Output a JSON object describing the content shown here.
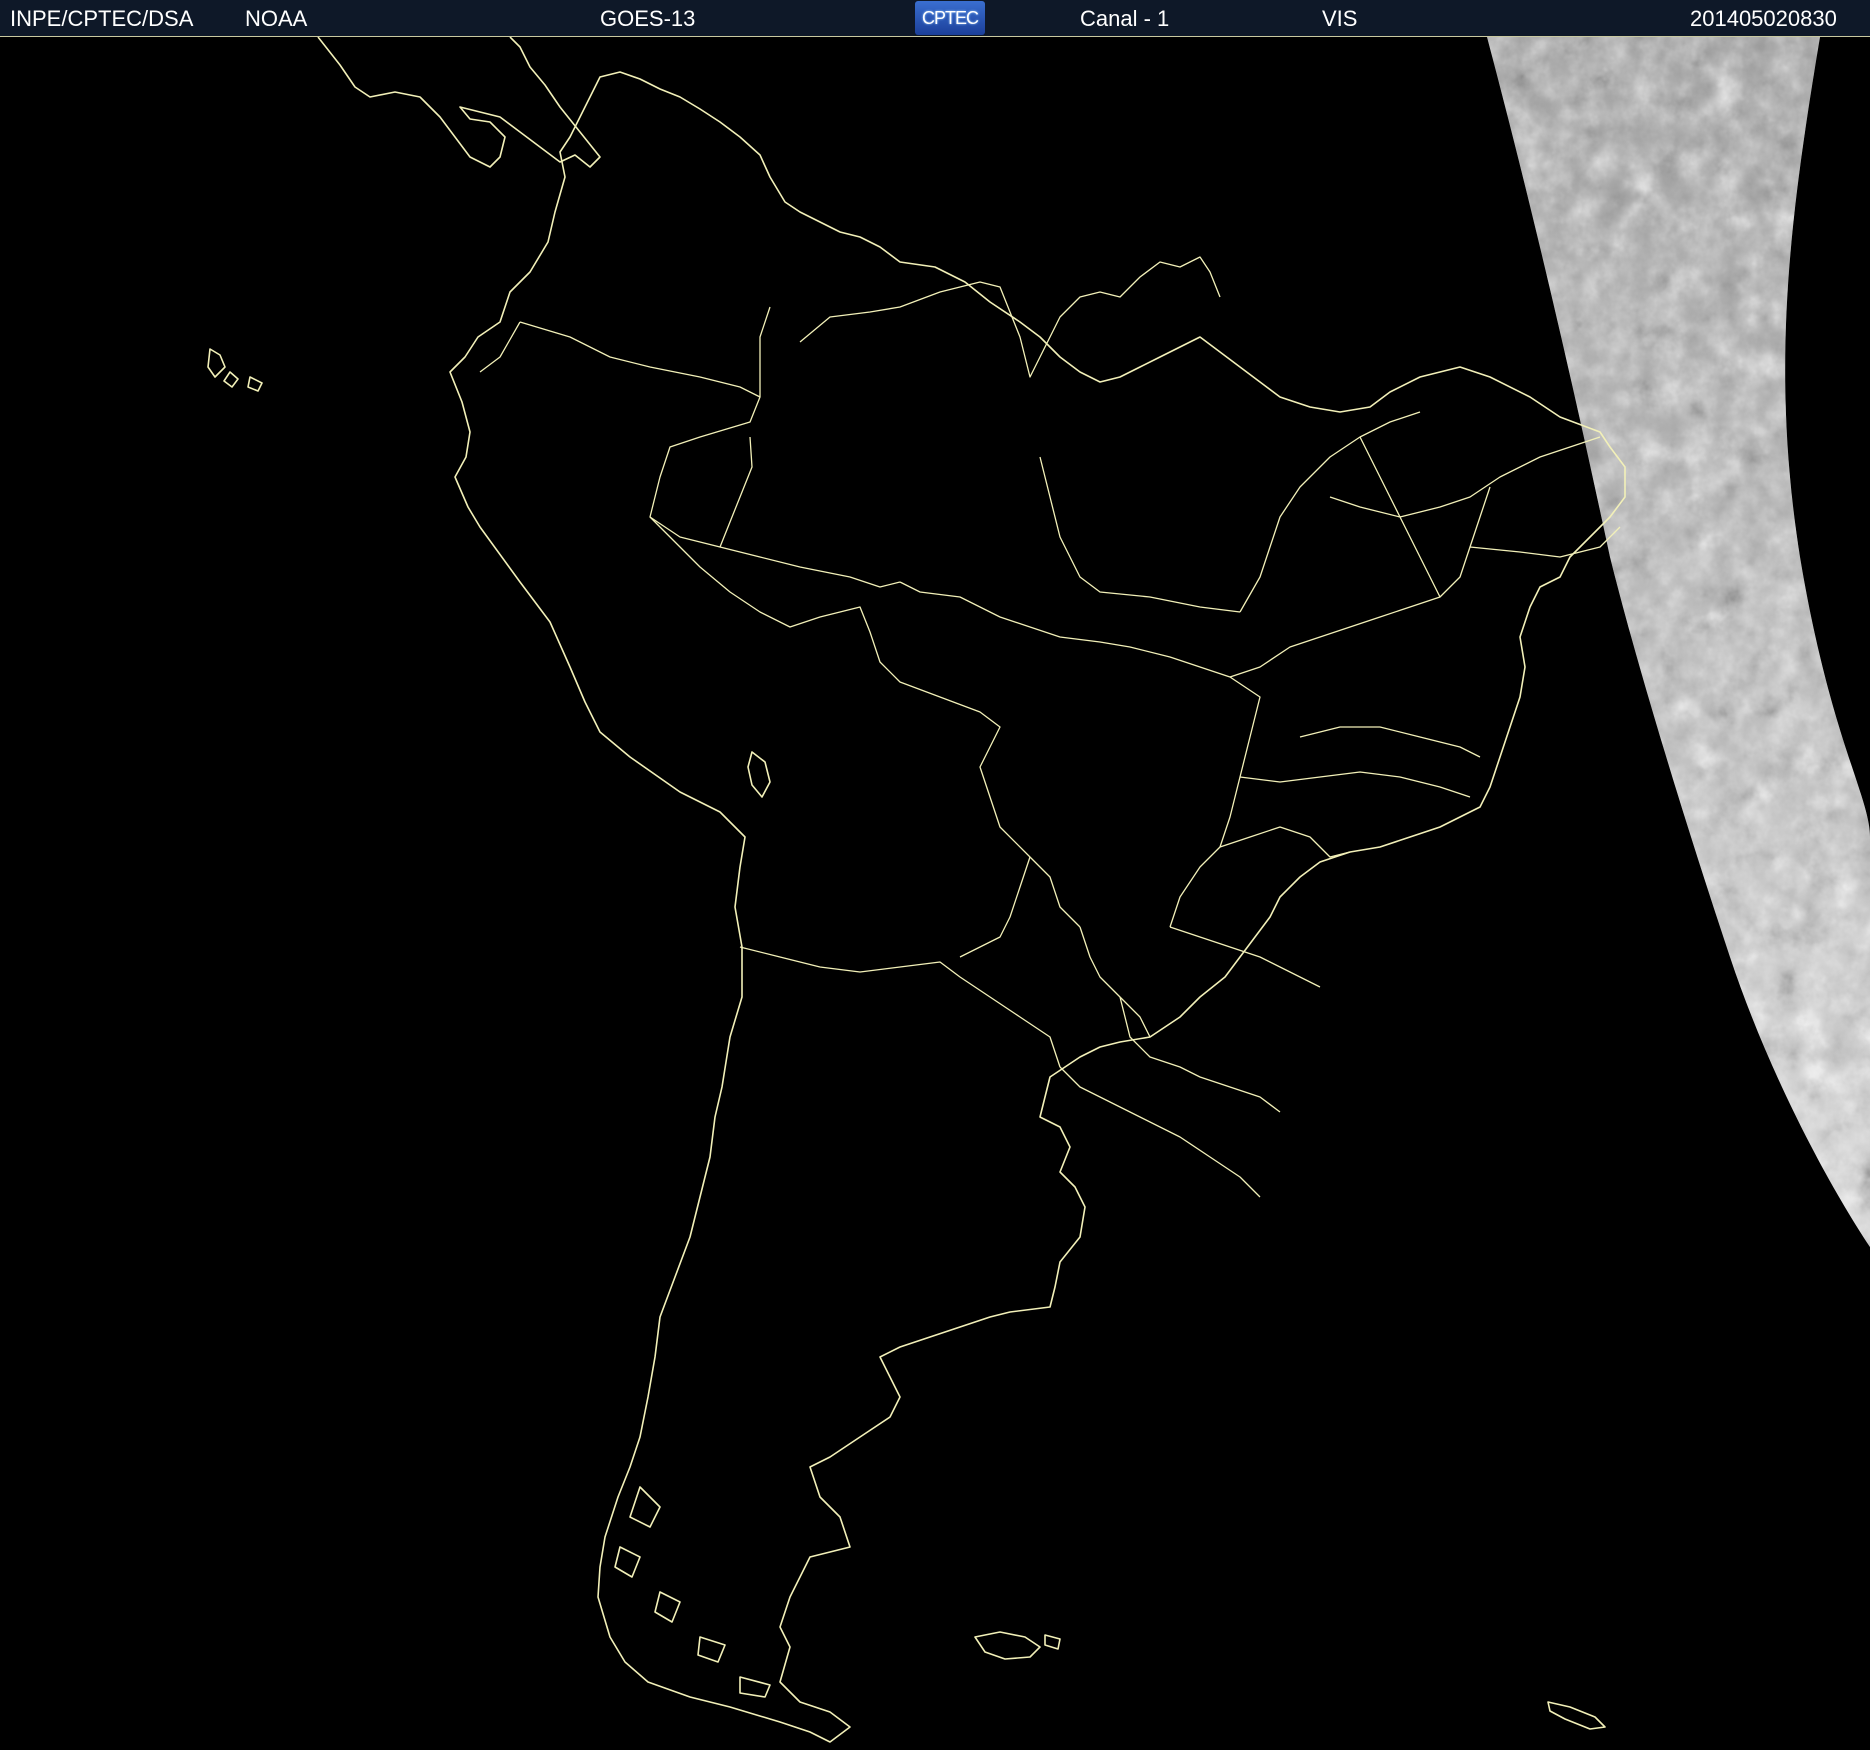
{
  "header": {
    "institution": "INPE/CPTEC/DSA",
    "agency": "NOAA",
    "satellite": "GOES-13",
    "logo_text": "CPTEC",
    "channel": "Canal - 1",
    "band": "VIS",
    "timestamp": "201405020830"
  },
  "map": {
    "background_color": "#000000",
    "outline_color": "#f2f0b8",
    "cloud_color": "#c8c8c8"
  }
}
